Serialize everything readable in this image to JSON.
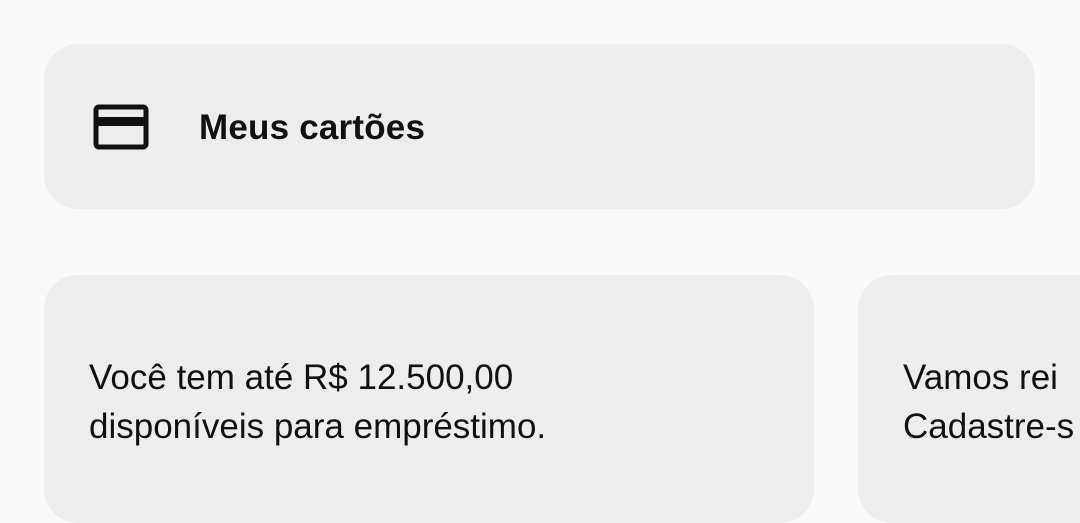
{
  "cards_button": {
    "icon": "credit-card-icon",
    "label": "Meus cartões"
  },
  "promo_cards": [
    {
      "line1": "Você tem até R$ 12.500,00",
      "line2": "disponíveis para empréstimo."
    },
    {
      "line1": "Vamos rei",
      "line2": "Cadastre-s"
    }
  ],
  "colors": {
    "background": "#f9f9f9",
    "card": "#ededed",
    "text": "#111111"
  }
}
